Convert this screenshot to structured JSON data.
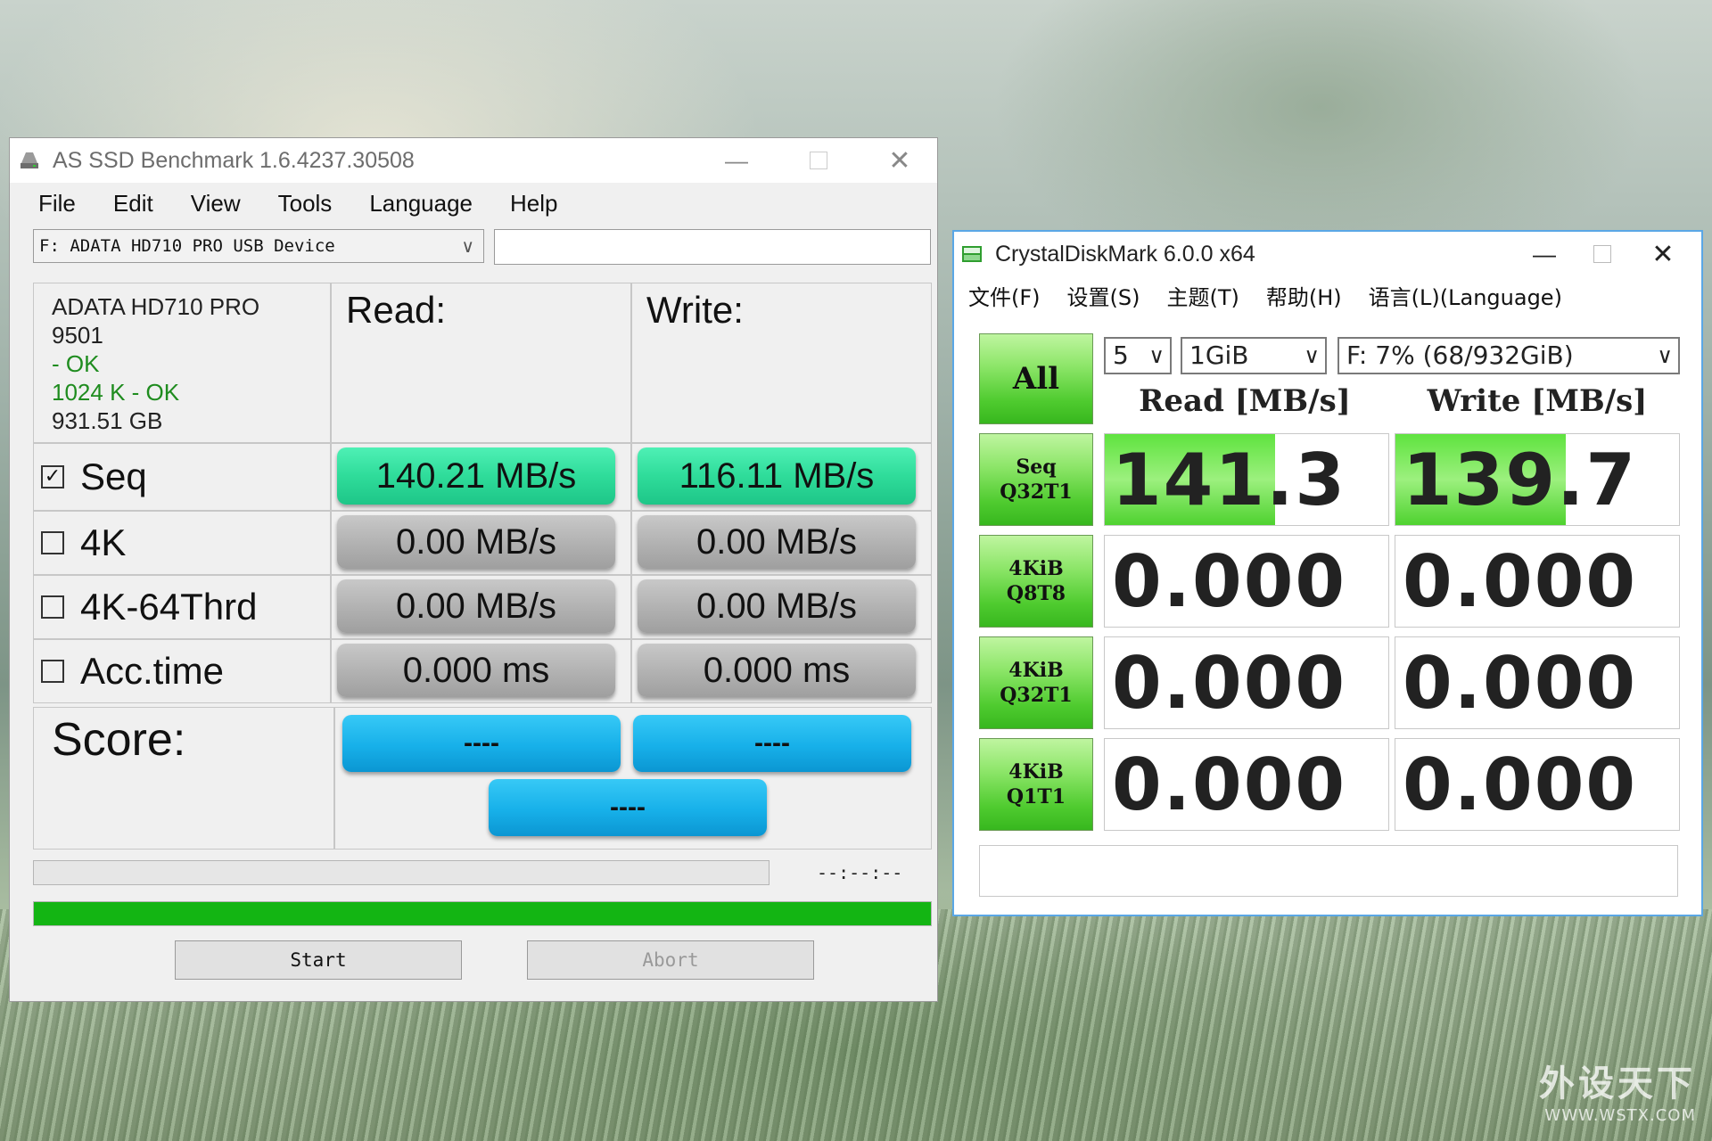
{
  "watermark": {
    "cn": "外设天下",
    "url": "WWW.WSTX.COM"
  },
  "asssd": {
    "title": "AS SSD Benchmark 1.6.4237.30508",
    "menu": [
      "File",
      "Edit",
      "View",
      "Tools",
      "Language",
      "Help"
    ],
    "drive": "F: ADATA HD710 PRO USB Device",
    "info": {
      "model": "ADATA HD710 PRO",
      "firmware": "9501",
      "driver_status": " - OK",
      "alignment": "1024 K - OK",
      "capacity": "931.51 GB"
    },
    "headers": {
      "read": "Read:",
      "write": "Write:"
    },
    "rows": [
      {
        "label": "Seq",
        "checked": true,
        "read": "140.21 MB/s",
        "write": "116.11 MB/s"
      },
      {
        "label": "4K",
        "checked": false,
        "read": "0.00 MB/s",
        "write": "0.00 MB/s"
      },
      {
        "label": "4K-64Thrd",
        "checked": false,
        "read": "0.00 MB/s",
        "write": "0.00 MB/s"
      },
      {
        "label": "Acc.time",
        "checked": false,
        "read": "0.000 ms",
        "write": "0.000 ms"
      }
    ],
    "score": {
      "label": "Score:",
      "read": "----",
      "write": "----",
      "total": "----"
    },
    "time": "--:--:--",
    "progress_fraction": 1.0,
    "buttons": {
      "start": "Start",
      "abort": "Abort"
    },
    "colors": {
      "seq_green": "#2fdc9a",
      "progress": "#13b513",
      "score_blue": "#17b0e9"
    }
  },
  "cdm": {
    "title": "CrystalDiskMark 6.0.0 x64",
    "menu": [
      "文件(F)",
      "设置(S)",
      "主题(T)",
      "帮助(H)",
      "语言(L)(Language)"
    ],
    "all_button": "All",
    "count": "5",
    "size": "1GiB",
    "drive": "F: 7% (68/932GiB)",
    "headers": {
      "read": "Read [MB/s]",
      "write": "Write [MB/s]"
    },
    "tests": [
      {
        "l1": "Seq",
        "l2": "Q32T1",
        "read": "141.3",
        "write": "139.7",
        "read_bar": 0.6,
        "write_bar": 0.6
      },
      {
        "l1": "4KiB",
        "l2": "Q8T8",
        "read": "0.000",
        "write": "0.000",
        "read_bar": 0,
        "write_bar": 0
      },
      {
        "l1": "4KiB",
        "l2": "Q32T1",
        "read": "0.000",
        "write": "0.000",
        "read_bar": 0,
        "write_bar": 0
      },
      {
        "l1": "4KiB",
        "l2": "Q1T1",
        "read": "0.000",
        "write": "0.000",
        "read_bar": 0,
        "write_bar": 0
      }
    ],
    "colors": {
      "button_green": "#4fcb2f",
      "bar_green": "#5fe33f",
      "border_blue": "#5aa7e6"
    }
  }
}
